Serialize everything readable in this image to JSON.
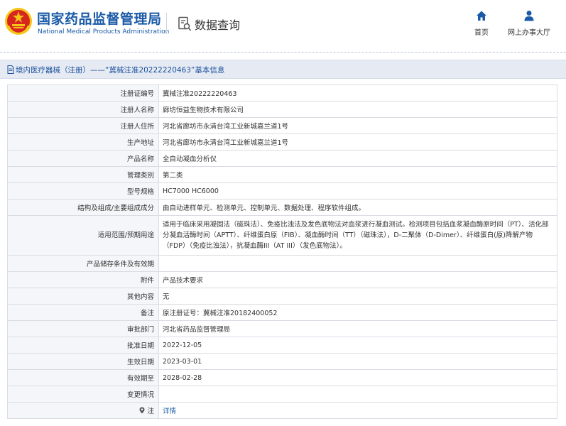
{
  "header": {
    "title": "国家药品监督管理局",
    "subtitle": "National Medical Products Administration",
    "query_label": "数据查询",
    "nav": {
      "home_label": "首页",
      "hall_label": "网上办事大厅"
    }
  },
  "breadcrumb": {
    "text": "境内医疗器械（注册）——“冀械注准20222220463”基本信息"
  },
  "colors": {
    "brand_blue": "#1a5aa6",
    "logo_red": "#d7261e",
    "logo_gold": "#f5c518",
    "crumb_bg": "#e6ebf3"
  },
  "icons": {
    "logo": "national-emblem-icon",
    "query": "document-search-icon",
    "home": "home-icon",
    "hall": "user-icon",
    "breadcrumb": "document-icon",
    "note": "location-pin-icon"
  },
  "rows": [
    {
      "label": "注册证编号",
      "value": "冀械注准20222220463"
    },
    {
      "label": "注册人名称",
      "value": "廊坊恒益生物技术有限公司"
    },
    {
      "label": "注册人住所",
      "value": "河北省廊坊市永清台湾工业新城嘉兰道1号"
    },
    {
      "label": "生产地址",
      "value": "河北省廊坊市永清台湾工业新城嘉兰道1号"
    },
    {
      "label": "产品名称",
      "value": "全自动凝血分析仪"
    },
    {
      "label": "管理类别",
      "value": "第二类"
    },
    {
      "label": "型号规格",
      "value": "HC7000 HC6000"
    },
    {
      "label": "结构及组成/主要组成成分",
      "value": "由自动进样单元、检测单元、控制单元、数据处理、程序软件组成。"
    },
    {
      "label": "适用范围/预期用途",
      "value": "适用于临床采用凝固法（磁珠法）、免疫比浊法及发色底物法对血浆进行凝血测试。检测项目包括血浆凝血酶原时间（PT）、活化部分凝血活酶时间（APTT）、纤维蛋白原（FIB）、凝血酶时间（TT）（磁珠法），D-二聚体（D-Dimer）、纤维蛋白(原)降解产物（FDP）（免疫比浊法），抗凝血酶III（AT III）（发色底物法）。"
    },
    {
      "label": "产品储存条件及有效期",
      "value": ""
    },
    {
      "label": "附件",
      "value": "产品技术要求"
    },
    {
      "label": "其他内容",
      "value": "无"
    },
    {
      "label": "备注",
      "value": "原注册证号：冀械注准20182400052"
    },
    {
      "label": "审批部门",
      "value": "河北省药品监督管理局"
    },
    {
      "label": "批准日期",
      "value": "2022-12-05"
    },
    {
      "label": "生效日期",
      "value": "2023-03-01"
    },
    {
      "label": "有效期至",
      "value": "2028-02-28"
    },
    {
      "label": "变更情况",
      "value": ""
    },
    {
      "label": "注",
      "value": "详情"
    }
  ]
}
